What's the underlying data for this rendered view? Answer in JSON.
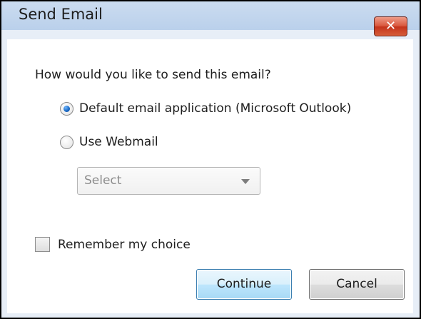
{
  "window": {
    "title": "Send Email",
    "close_icon": "close-icon",
    "close_glyph": "✕"
  },
  "question": "How would you like to send this email?",
  "options": [
    {
      "label": "Default email application (Microsoft Outlook)",
      "selected": true
    },
    {
      "label": "Use Webmail",
      "selected": false
    }
  ],
  "webmail_select": {
    "value": "Select",
    "enabled": false
  },
  "remember": {
    "label": "Remember my choice",
    "checked": false
  },
  "buttons": {
    "continue_label": "Continue",
    "cancel_label": "Cancel"
  },
  "colors": {
    "titlebar": "#bad0eb",
    "close_button": "#c4331b",
    "radio_selected": "#1565c0",
    "continue_border": "#3c7fb1"
  }
}
